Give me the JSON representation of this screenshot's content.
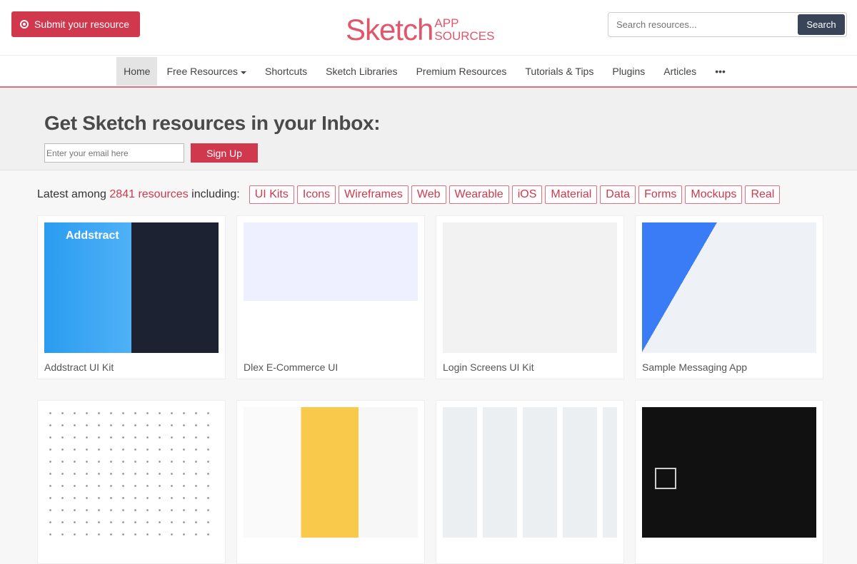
{
  "header": {
    "submit_label": "Submit your resource",
    "logo_main": "Sketch",
    "logo_app": "APP",
    "logo_sources": "SOURCES",
    "search_placeholder": "Search resources...",
    "search_button": "Search"
  },
  "nav": {
    "items": [
      "Home",
      "Free Resources",
      "Shortcuts",
      "Sketch Libraries",
      "Premium Resources",
      "Tutorials & Tips",
      "Plugins",
      "Articles",
      "•••"
    ]
  },
  "newsletter": {
    "title": "Get Sketch resources in your Inbox:",
    "email_placeholder": "Enter your email here",
    "signup_label": "Sign Up"
  },
  "latest": {
    "prefix": "Latest among ",
    "count": "2841 resources",
    "suffix": " including:",
    "tags": [
      "UI Kits",
      "Icons",
      "Wireframes",
      "Web",
      "Wearable",
      "iOS",
      "Material",
      "Data",
      "Forms",
      "Mockups",
      "Real"
    ]
  },
  "cards": [
    {
      "title": "Addstract UI Kit",
      "thumb_text": "Addstract"
    },
    {
      "title": "Dlex E-Commerce UI"
    },
    {
      "title": "Login Screens UI Kit"
    },
    {
      "title": "Sample Messaging App"
    },
    {
      "title": ""
    },
    {
      "title": ""
    },
    {
      "title": ""
    },
    {
      "title": ""
    }
  ],
  "colors": {
    "accent": "#d0384e",
    "search_button": "#3a4458"
  }
}
